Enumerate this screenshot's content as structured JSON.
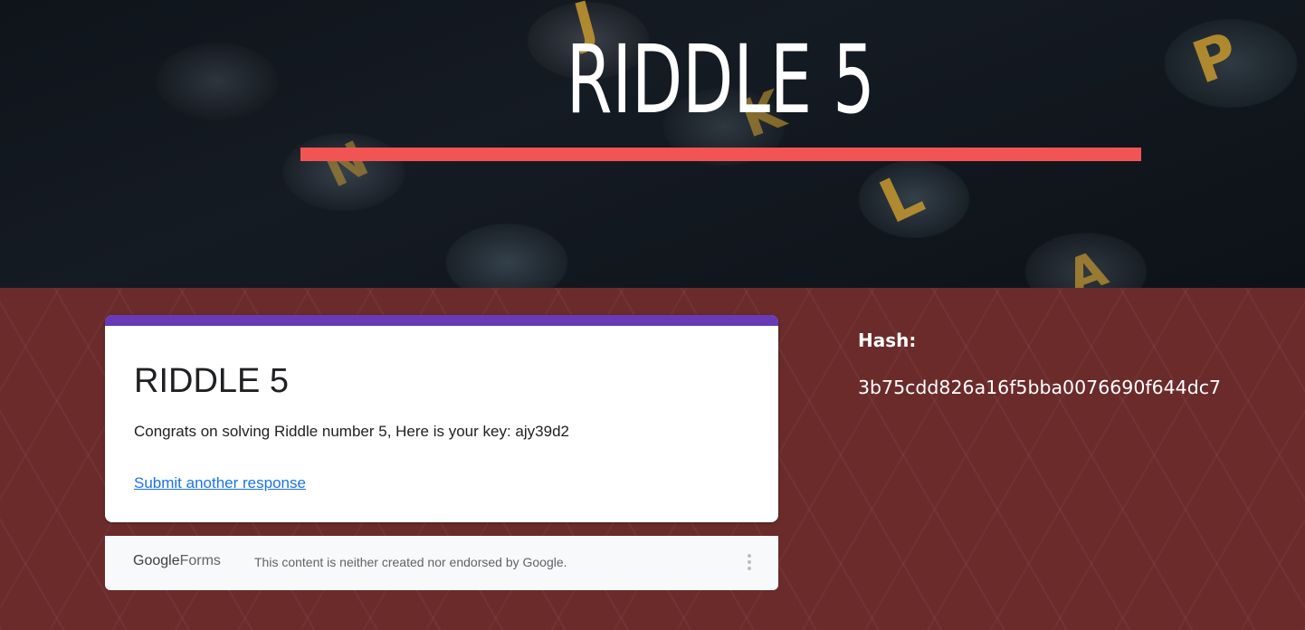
{
  "header": {
    "title": "RIDDLE 5",
    "underline_color": "#f25454",
    "background": "typewriter-keys-photo"
  },
  "form_card": {
    "accent_color": "#673ab7",
    "title": "RIDDLE 5",
    "message": "Congrats on solving Riddle number 5, Here is your key: ajy39d2",
    "link_label": "Submit another response"
  },
  "footer": {
    "logo_google": "Google",
    "logo_forms": "Forms",
    "disclaimer": "This content is neither created nor endorsed by Google.",
    "menu_icon": "more-vert-icon"
  },
  "side_panel": {
    "hash_label": "Hash:",
    "hash_value": "3b75cdd826a16f5bba0076690f644dc7"
  }
}
